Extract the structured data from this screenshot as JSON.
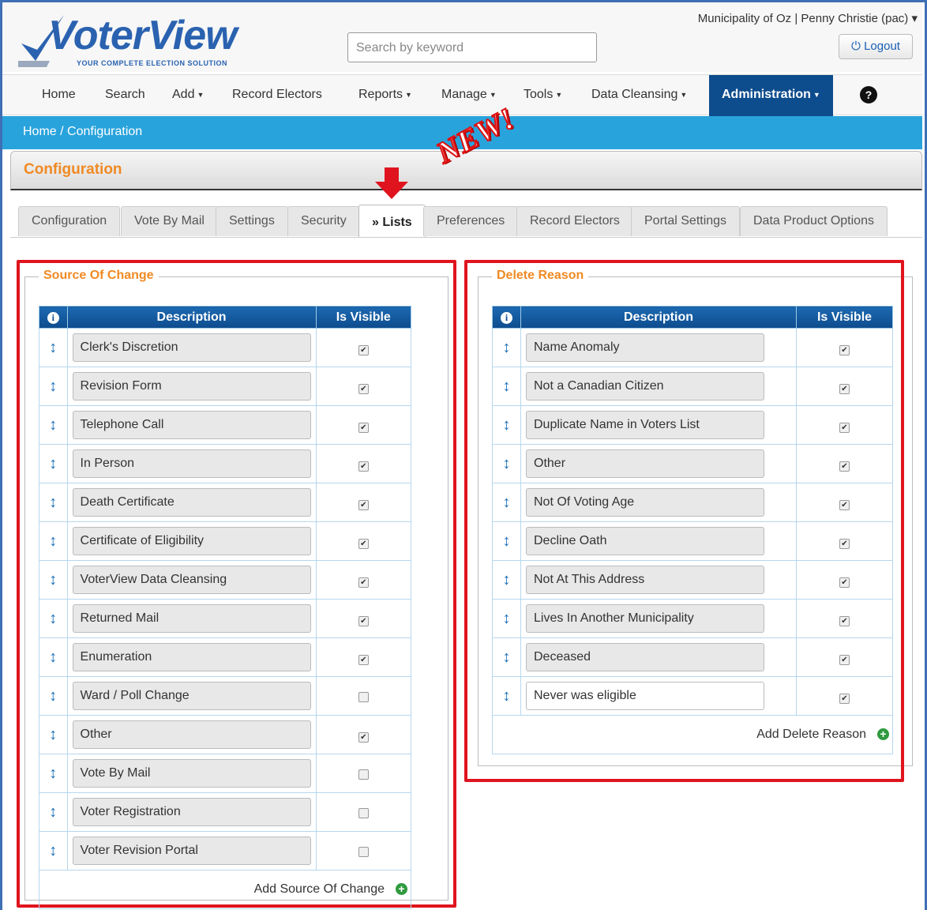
{
  "header": {
    "logo_text": "VoterView",
    "logo_tagline": "YOUR COMPLETE ELECTION SOLUTION",
    "search_placeholder": "Search by keyword",
    "user_info": "Municipality of Oz | Penny Christie (pac) ▾",
    "logout_label": "Logout"
  },
  "nav": {
    "items": [
      {
        "label": "Home"
      },
      {
        "label": "Search"
      },
      {
        "label": "Add"
      },
      {
        "label": "Record Electors"
      },
      {
        "label": "Reports"
      },
      {
        "label": "Manage"
      },
      {
        "label": "Tools"
      },
      {
        "label": "Data Cleansing"
      },
      {
        "label": "Administration"
      }
    ]
  },
  "breadcrumb": "Home / Configuration",
  "page_title": "Configuration",
  "new_badge": "NEW!",
  "tabs": [
    {
      "label": "Configuration"
    },
    {
      "label": "Vote By Mail"
    },
    {
      "label": "Settings"
    },
    {
      "label": "Security"
    },
    {
      "label": "» Lists"
    },
    {
      "label": "Preferences"
    },
    {
      "label": "Record Electors"
    },
    {
      "label": "Portal Settings"
    },
    {
      "label": "Data Product Options"
    }
  ],
  "source_of_change": {
    "legend": "Source Of Change",
    "col_description": "Description",
    "col_visible": "Is Visible",
    "add_label": "Add Source Of Change",
    "rows": [
      {
        "description": "Clerk's Discretion",
        "visible": true
      },
      {
        "description": "Revision Form",
        "visible": true
      },
      {
        "description": "Telephone Call",
        "visible": true
      },
      {
        "description": "In Person",
        "visible": true
      },
      {
        "description": "Death Certificate",
        "visible": true
      },
      {
        "description": "Certificate of Eligibility",
        "visible": true
      },
      {
        "description": "VoterView Data Cleansing",
        "visible": true
      },
      {
        "description": "Returned Mail",
        "visible": true
      },
      {
        "description": "Enumeration",
        "visible": true
      },
      {
        "description": "Ward / Poll Change",
        "visible": false
      },
      {
        "description": "Other",
        "visible": true
      },
      {
        "description": "Vote By Mail",
        "visible": false
      },
      {
        "description": "Voter Registration",
        "visible": false
      },
      {
        "description": "Voter Revision Portal",
        "visible": false
      }
    ]
  },
  "delete_reason": {
    "legend": "Delete Reason",
    "col_description": "Description",
    "col_visible": "Is Visible",
    "add_label": "Add Delete Reason",
    "rows": [
      {
        "description": "Name Anomaly",
        "visible": true
      },
      {
        "description": "Not a Canadian Citizen",
        "visible": true
      },
      {
        "description": "Duplicate Name in Voters List",
        "visible": true
      },
      {
        "description": "Other",
        "visible": true
      },
      {
        "description": "Not Of Voting Age",
        "visible": true
      },
      {
        "description": "Decline Oath",
        "visible": true
      },
      {
        "description": "Not At This Address",
        "visible": true
      },
      {
        "description": "Lives In Another Municipality",
        "visible": true
      },
      {
        "description": "Deceased",
        "visible": true
      },
      {
        "description": "Never was eligible",
        "visible": true
      }
    ]
  }
}
